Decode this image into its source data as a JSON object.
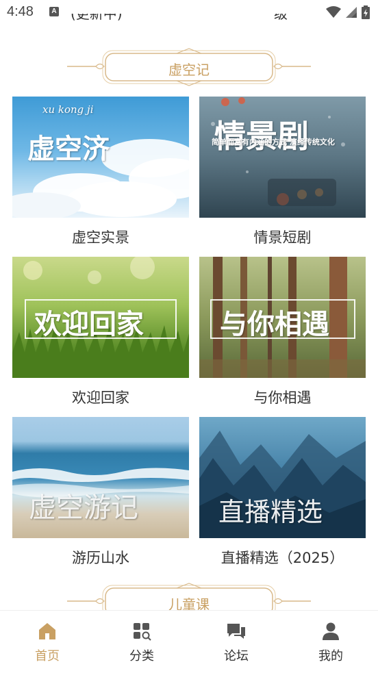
{
  "status_bar": {
    "time": "4:48",
    "notification_letter": "A"
  },
  "top_cut": {
    "left_text": "(更新中)",
    "right_text": "级"
  },
  "sections": [
    {
      "title": "虚空记"
    },
    {
      "title": "儿童课"
    }
  ],
  "cards": [
    {
      "label": "虚空实景",
      "overlay_main": "虚空济",
      "overlay_small": "xu kong ji"
    },
    {
      "label": "情景短剧",
      "overlay_main": "情景剧",
      "overlay_small": "简单而富有内涵的方式  演绎传统文化"
    },
    {
      "label": "欢迎回家",
      "overlay_main": "欢迎回家"
    },
    {
      "label": "与你相遇",
      "overlay_main": "与你相遇"
    },
    {
      "label": "游历山水",
      "overlay_main": "虚空游记"
    },
    {
      "label": "直播精选（2025）",
      "overlay_main": "直播精选"
    }
  ],
  "bottom_nav": [
    {
      "label": "首页",
      "icon": "home-icon",
      "active": true
    },
    {
      "label": "分类",
      "icon": "category-icon",
      "active": false
    },
    {
      "label": "论坛",
      "icon": "forum-icon",
      "active": false
    },
    {
      "label": "我的",
      "icon": "profile-icon",
      "active": false
    }
  ],
  "colors": {
    "accent": "#c9a063",
    "text": "#333333",
    "nav_inactive": "#555555"
  }
}
